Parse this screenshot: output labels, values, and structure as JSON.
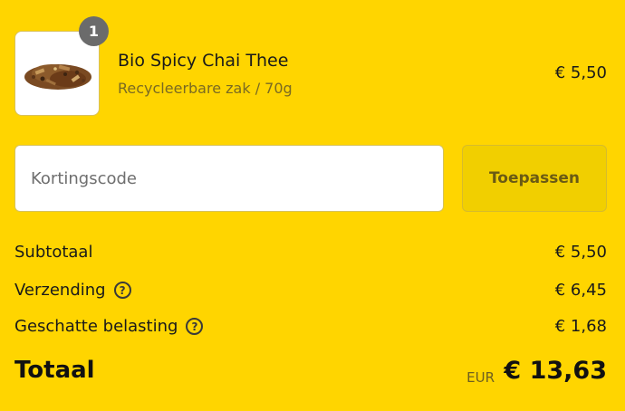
{
  "product": {
    "quantity": "1",
    "name": "Bio Spicy Chai Thee",
    "variant": "Recycleerbare zak / 70g",
    "price": "€ 5,50",
    "image_icon": "spice-mix-image"
  },
  "discount": {
    "placeholder": "Kortingscode",
    "value": "",
    "apply_label": "Toepassen"
  },
  "summary": {
    "subtotal_label": "Subtotaal",
    "subtotal_value": "€ 5,50",
    "shipping_label": "Verzending",
    "shipping_value": "€ 6,45",
    "tax_label": "Geschatte belasting",
    "tax_value": "€ 1,68",
    "help_icon": "question-circle-icon",
    "total_label": "Totaal",
    "total_currency": "EUR",
    "total_value": "€ 13,63"
  },
  "colors": {
    "background": "#ffd500",
    "button": "#f1cf00",
    "badge": "#6b6b6b"
  }
}
